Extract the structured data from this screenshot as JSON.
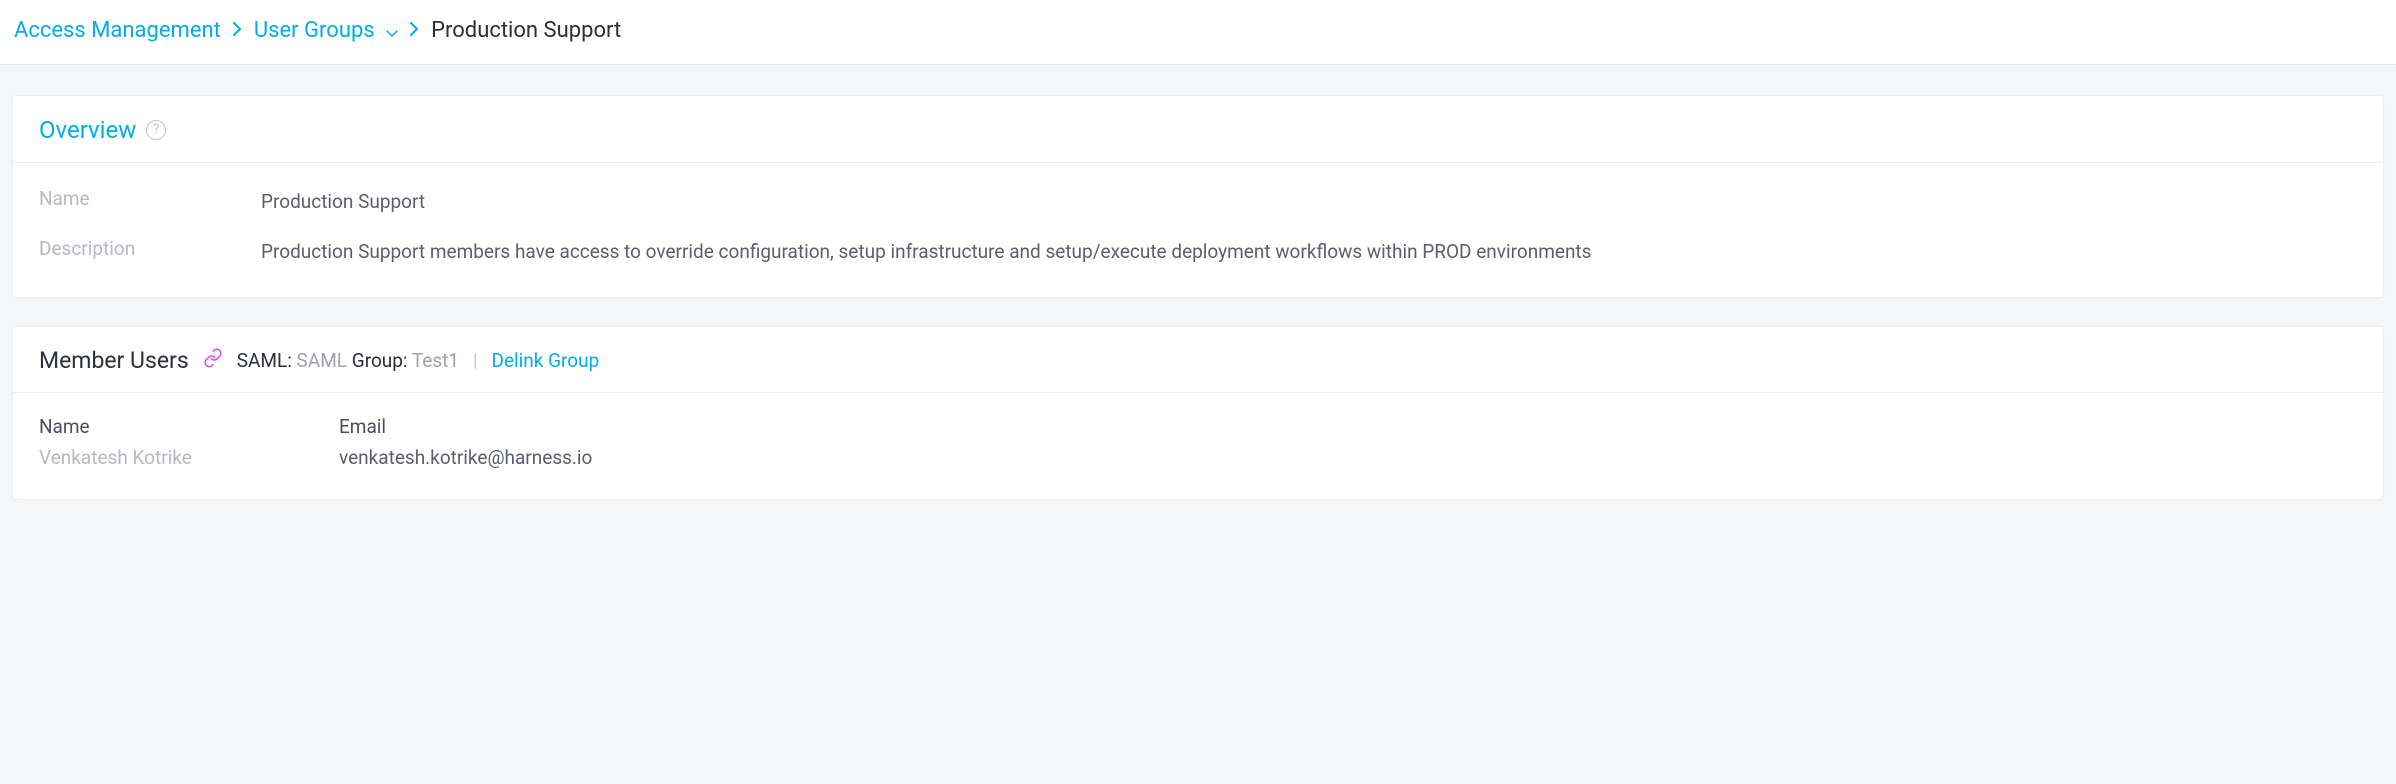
{
  "breadcrumb": {
    "root": "Access Management",
    "level1": "User Groups",
    "current": "Production Support"
  },
  "overview": {
    "title": "Overview",
    "name_label": "Name",
    "name_value": "Production Support",
    "description_label": "Description",
    "description_value": "Production Support members have access to override configuration, setup infrastructure and setup/execute deployment workflows within PROD environments"
  },
  "members": {
    "title": "Member Users",
    "saml_label": "SAML:",
    "saml_value": "SAML",
    "group_label": "Group:",
    "group_value": "Test1",
    "delink_label": "Delink Group",
    "columns": {
      "name": "Name",
      "email": "Email"
    },
    "rows": [
      {
        "name": "Venkatesh Kotrike",
        "email": "venkatesh.kotrike@harness.io"
      }
    ]
  }
}
